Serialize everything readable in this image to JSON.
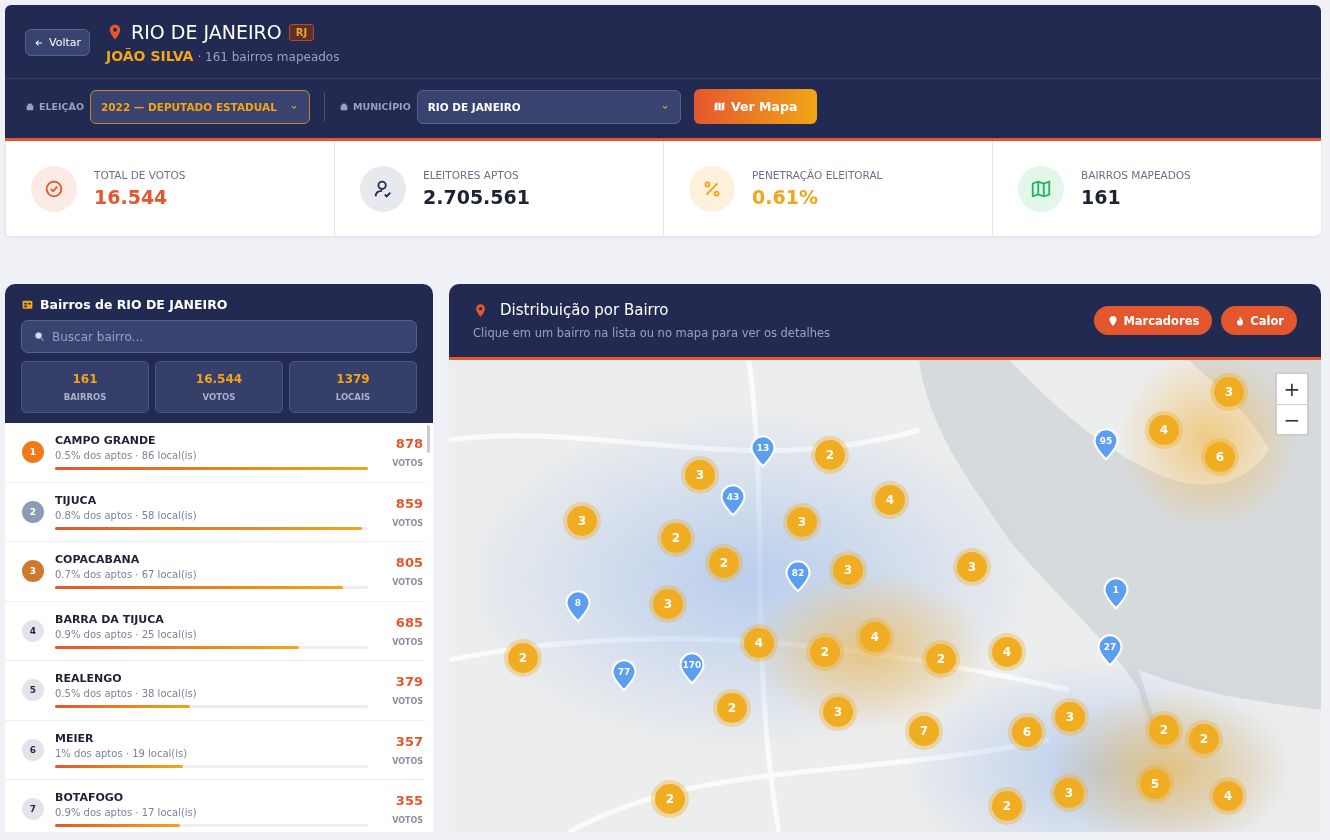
{
  "header": {
    "back_button": "Voltar",
    "city": "RIO DE JANEIRO",
    "state_badge": "RJ",
    "candidate": "JOÃO SILVA",
    "subtitle": "· 161 bairros mapeados"
  },
  "filters": {
    "election_label": "ELEIÇÃO",
    "election_value": "2022 — DEPUTADO ESTADUAL",
    "municipality_label": "MUNICÍPIO",
    "municipality_value": "RIO DE JANEIRO",
    "map_button": "Ver Mapa"
  },
  "stats": [
    {
      "kind": "check",
      "label": "TOTAL DE VOTOS",
      "value": "16.544",
      "color": "#e4572e"
    },
    {
      "kind": "voter",
      "label": "ELEITORES APTOS",
      "value": "2.705.561",
      "color": "#1e2235"
    },
    {
      "kind": "percent",
      "label": "PENETRAÇÃO ELEITORAL",
      "value": "0.61%",
      "color": "#f2a516"
    },
    {
      "kind": "map",
      "label": "BAIRROS MAPEADOS",
      "value": "161",
      "color": "#1e2235"
    }
  ],
  "neighborhoods": {
    "title": "Bairros de RIO DE JANEIRO",
    "search_placeholder": "Buscar bairro...",
    "summary": [
      {
        "value": "161",
        "label": "BAIRROS"
      },
      {
        "value": "16.544",
        "label": "VOTOS"
      },
      {
        "value": "1379",
        "label": "LOCAIS"
      }
    ],
    "rows": [
      {
        "rank": "1",
        "name": "CAMPO GRANDE",
        "detail": "0.5% dos aptos · 86 local(is)",
        "votes": "878",
        "votes_label": "VOTOS",
        "level": 1,
        "color": "#f07a1a"
      },
      {
        "rank": "2",
        "name": "TIJUCA",
        "detail": "0.8% dos aptos · 58 local(is)",
        "votes": "859",
        "votes_label": "VOTOS",
        "level": 0.98,
        "color": "#8e9bb5"
      },
      {
        "rank": "3",
        "name": "COPACABANA",
        "detail": "0.7% dos aptos · 67 local(is)",
        "votes": "805",
        "votes_label": "VOTOS",
        "level": 0.92,
        "color": "#cd7a2c"
      },
      {
        "rank": "4",
        "name": "BARRA DA TIJUCA",
        "detail": "0.9% dos aptos · 25 local(is)",
        "votes": "685",
        "votes_label": "VOTOS",
        "level": 0.78,
        "color": "#e2e4ea"
      },
      {
        "rank": "5",
        "name": "REALENGO",
        "detail": "0.5% dos aptos · 38 local(is)",
        "votes": "379",
        "votes_label": "VOTOS",
        "level": 0.43,
        "color": "#e2e4ea"
      },
      {
        "rank": "6",
        "name": "MEIER",
        "detail": "1% dos aptos · 19 local(is)",
        "votes": "357",
        "votes_label": "VOTOS",
        "level": 0.41,
        "color": "#e2e4ea"
      },
      {
        "rank": "7",
        "name": "BOTAFOGO",
        "detail": "0.9% dos aptos · 17 local(is)",
        "votes": "355",
        "votes_label": "VOTOS",
        "level": 0.4,
        "color": "#e2e4ea"
      }
    ]
  },
  "map": {
    "title": "Distribuição por Bairro",
    "subtitle": "Clique em um bairro na lista ou no mapa para ver os detalhes",
    "buttons": [
      {
        "kind": "pin",
        "label": "Marcadores"
      },
      {
        "kind": "flame",
        "label": "Calor"
      }
    ],
    "zoom_in": "+",
    "zoom_out": "−",
    "markers": [
      {
        "kind": "cluster",
        "label": "3"
      },
      {
        "kind": "cluster",
        "label": "2"
      },
      {
        "kind": "cluster",
        "label": "3"
      },
      {
        "kind": "cluster",
        "label": "2"
      },
      {
        "kind": "cluster",
        "label": "4"
      },
      {
        "kind": "cluster",
        "label": "3"
      },
      {
        "kind": "cluster",
        "label": "2"
      },
      {
        "kind": "cluster",
        "label": "3"
      },
      {
        "kind": "cluster",
        "label": "3"
      },
      {
        "kind": "cluster",
        "label": "3"
      },
      {
        "kind": "cluster",
        "label": "4"
      },
      {
        "kind": "cluster",
        "label": "4"
      },
      {
        "kind": "cluster",
        "label": "2"
      },
      {
        "kind": "cluster",
        "label": "2"
      },
      {
        "kind": "cluster",
        "label": "4"
      },
      {
        "kind": "cluster",
        "label": "2"
      },
      {
        "kind": "cluster",
        "label": "2"
      },
      {
        "kind": "cluster",
        "label": "3"
      },
      {
        "kind": "cluster",
        "label": "7"
      },
      {
        "kind": "cluster",
        "label": "6"
      },
      {
        "kind": "cluster",
        "label": "3"
      },
      {
        "kind": "cluster",
        "label": "2"
      },
      {
        "kind": "cluster",
        "label": "2"
      },
      {
        "kind": "cluster",
        "label": "5"
      },
      {
        "kind": "cluster",
        "label": "3"
      },
      {
        "kind": "cluster",
        "label": "2"
      },
      {
        "kind": "cluster",
        "label": "2"
      },
      {
        "kind": "cluster",
        "label": "4"
      },
      {
        "kind": "cluster",
        "label": "4"
      },
      {
        "kind": "cluster",
        "label": "6"
      },
      {
        "kind": "cluster",
        "label": "3"
      },
      {
        "kind": "pin",
        "label": "13"
      },
      {
        "kind": "pin",
        "label": "43"
      },
      {
        "kind": "pin",
        "label": "82"
      },
      {
        "kind": "pin",
        "label": "8"
      },
      {
        "kind": "pin",
        "label": "77"
      },
      {
        "kind": "pin",
        "label": "170"
      },
      {
        "kind": "pin",
        "label": "95"
      },
      {
        "kind": "pin",
        "label": "1"
      },
      {
        "kind": "pin",
        "label": "27"
      }
    ]
  }
}
